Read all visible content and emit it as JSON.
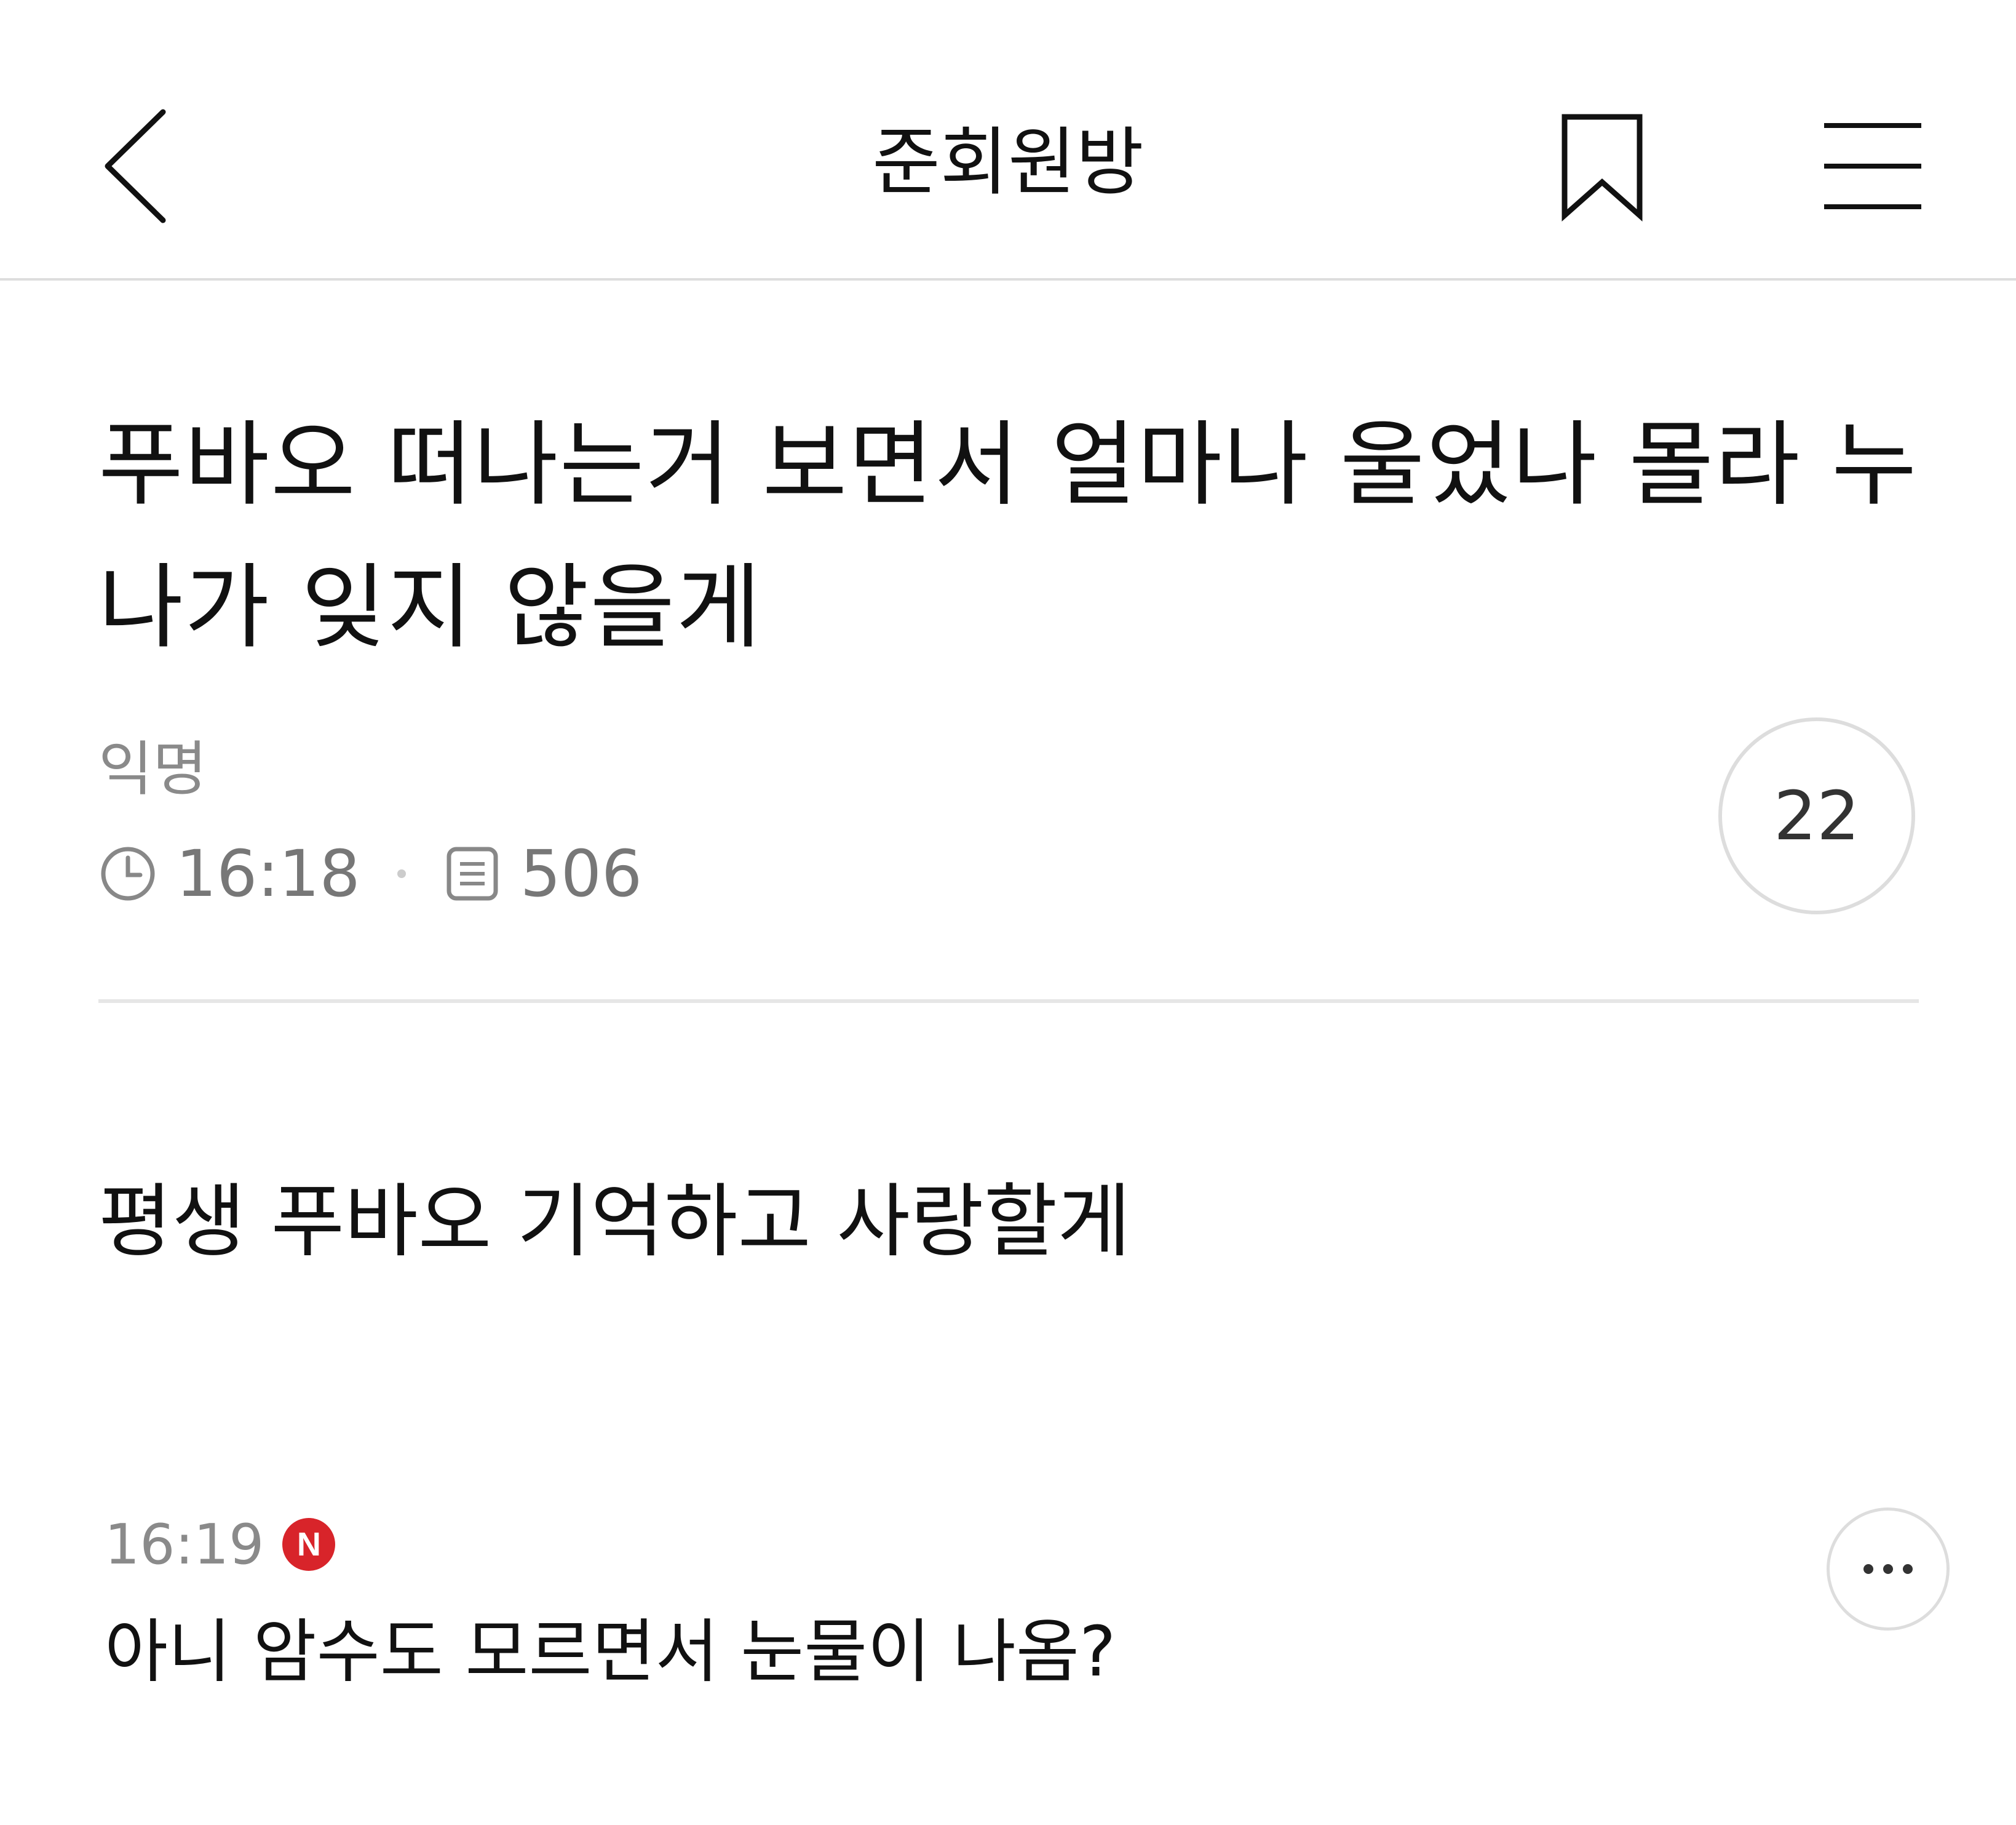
{
  "header": {
    "title": "준회원방",
    "back_icon": "chevron-left-icon",
    "bookmark_icon": "bookmark-icon",
    "menu_icon": "hamburger-menu-icon"
  },
  "post": {
    "title": "푸바오 떠나는거 보면서 얼마나 울었나 몰라 누나가 잊지 않을게",
    "author": "익명",
    "time": "16:18",
    "views": "506",
    "comment_count": "22",
    "body": "평생 푸바오 기억하고 사랑할게"
  },
  "comments": [
    {
      "time": "16:19",
      "badge": "N",
      "text": "아니 암수도 모르면서 눈물이 나옴?"
    }
  ],
  "colors": {
    "badge_red": "#d8242a",
    "divider": "#e6e6e6",
    "meta_gray": "#777777"
  }
}
